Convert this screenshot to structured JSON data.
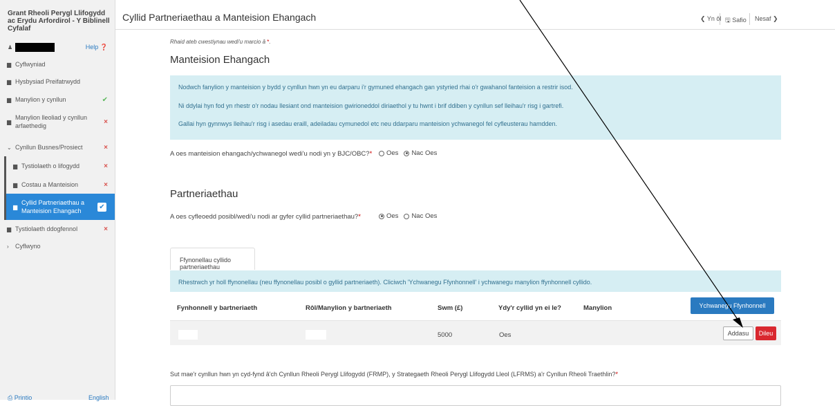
{
  "sidebar": {
    "app_title": "Grant Rheoli Perygl Llifogydd ac Erydu Arfordirol - Y Biblinell Cyfalaf",
    "help_label": "Help",
    "items": [
      {
        "label": "Cyflwyniad",
        "status": ""
      },
      {
        "label": "Hysbysiad Preifatrwydd",
        "status": ""
      },
      {
        "label": "Manylion y cynllun",
        "status": "✔"
      },
      {
        "label": "Manylion lleoliad y cynllun arfaethedig",
        "status": "×"
      },
      {
        "label": "Cynllun Busnes/Prosiect",
        "status": "×"
      },
      {
        "label": "Tystiolaeth o lifogydd",
        "status": "×"
      },
      {
        "label": "Costau a Manteision",
        "status": "×"
      },
      {
        "label": "Cyllid Partneriaethau a Manteision Ehangach",
        "status": "✔"
      },
      {
        "label": "Tystiolaeth ddogfennol",
        "status": "×"
      },
      {
        "label": "Cyflwyno",
        "status": ""
      }
    ],
    "footer_print": "Printio",
    "footer_lang": "English"
  },
  "header": {
    "title": "Cyllid Partneriaethau a Manteision Ehangach",
    "back_label": "Yn ôl",
    "save_label": "Safio",
    "next_label": "Nesaf"
  },
  "main": {
    "required_note": "Rhaid ateb cwestiynau wedi'u marcio â",
    "required_star": "*",
    "benefits_heading": "Manteision Ehangach",
    "benefits_info": [
      "Nodwch fanylion y manteision y bydd y cynllun hwn yn eu darparu i'r gymuned ehangach gan ystyried rhai o'r gwahanol fanteision a restrir isod.",
      "Ni ddylai hyn fod yn rhestr o'r nodau llesiant ond manteision gwirioneddol diriaethol y tu hwnt i brif ddiben y cynllun sef lleihau'r risg i gartrefi.",
      "Gallai hyn gynnwys lleihau'r risg i asedau eraill, adeiladau cymunedol etc neu ddarparu manteision ychwanegol fel cyfleusterau hamdden."
    ],
    "q1_label": "A oes manteision ehangach/ychwanegol wedi'u nodi yn y BJC/OBC?",
    "q1_options": [
      "Oes",
      "Nac Oes"
    ],
    "q1_selected": "Nac Oes",
    "partnership_heading": "Partneriaethau",
    "q2_label": "A oes cyfleoedd posibl/wedi'u nodi ar gyfer cyllid partneriaethau?",
    "q2_options": [
      "Oes",
      "Nac Oes"
    ],
    "q2_selected": "Oes",
    "tab_label": "Ffynonellau cyllido partneriaethau",
    "tab_info": "Rhestrwch yr holl ffynonellau (neu ffynonellau posibl o gyllid partneriaeth). Cliciwch 'Ychwanegu Ffynhonnell' i ychwanegu manylion ffynhonnell cyllido.",
    "table": {
      "headers": [
        "Fynhonnell y bartneriaeth",
        "Rôl/Manylion y bartneriaeth",
        "Swm (£)",
        "Ydy'r cyllid yn ei le?",
        "Manylion"
      ],
      "add_button": "Ychwanegu Ffynhonnell",
      "rows": [
        {
          "source": "",
          "role": "",
          "amount": "5000",
          "in_place": "Oes",
          "details": "",
          "edit_label": "Addasu",
          "delete_label": "Dileu"
        }
      ]
    },
    "bottom_question": "Sut mae'r cynllun hwn yn cyd-fynd â'ch Cynllun Rheoli Perygl Llifogydd (FRMP), y Strategaeth Rheoli Perygl Llifogydd Lleol (LFRMS) a'r Cynllun Rheoli Traethlin?"
  },
  "colors": {
    "accent": "#2a88d8",
    "info_bg": "#d6eef3",
    "danger": "#d9282f",
    "success": "#5cb85c"
  }
}
